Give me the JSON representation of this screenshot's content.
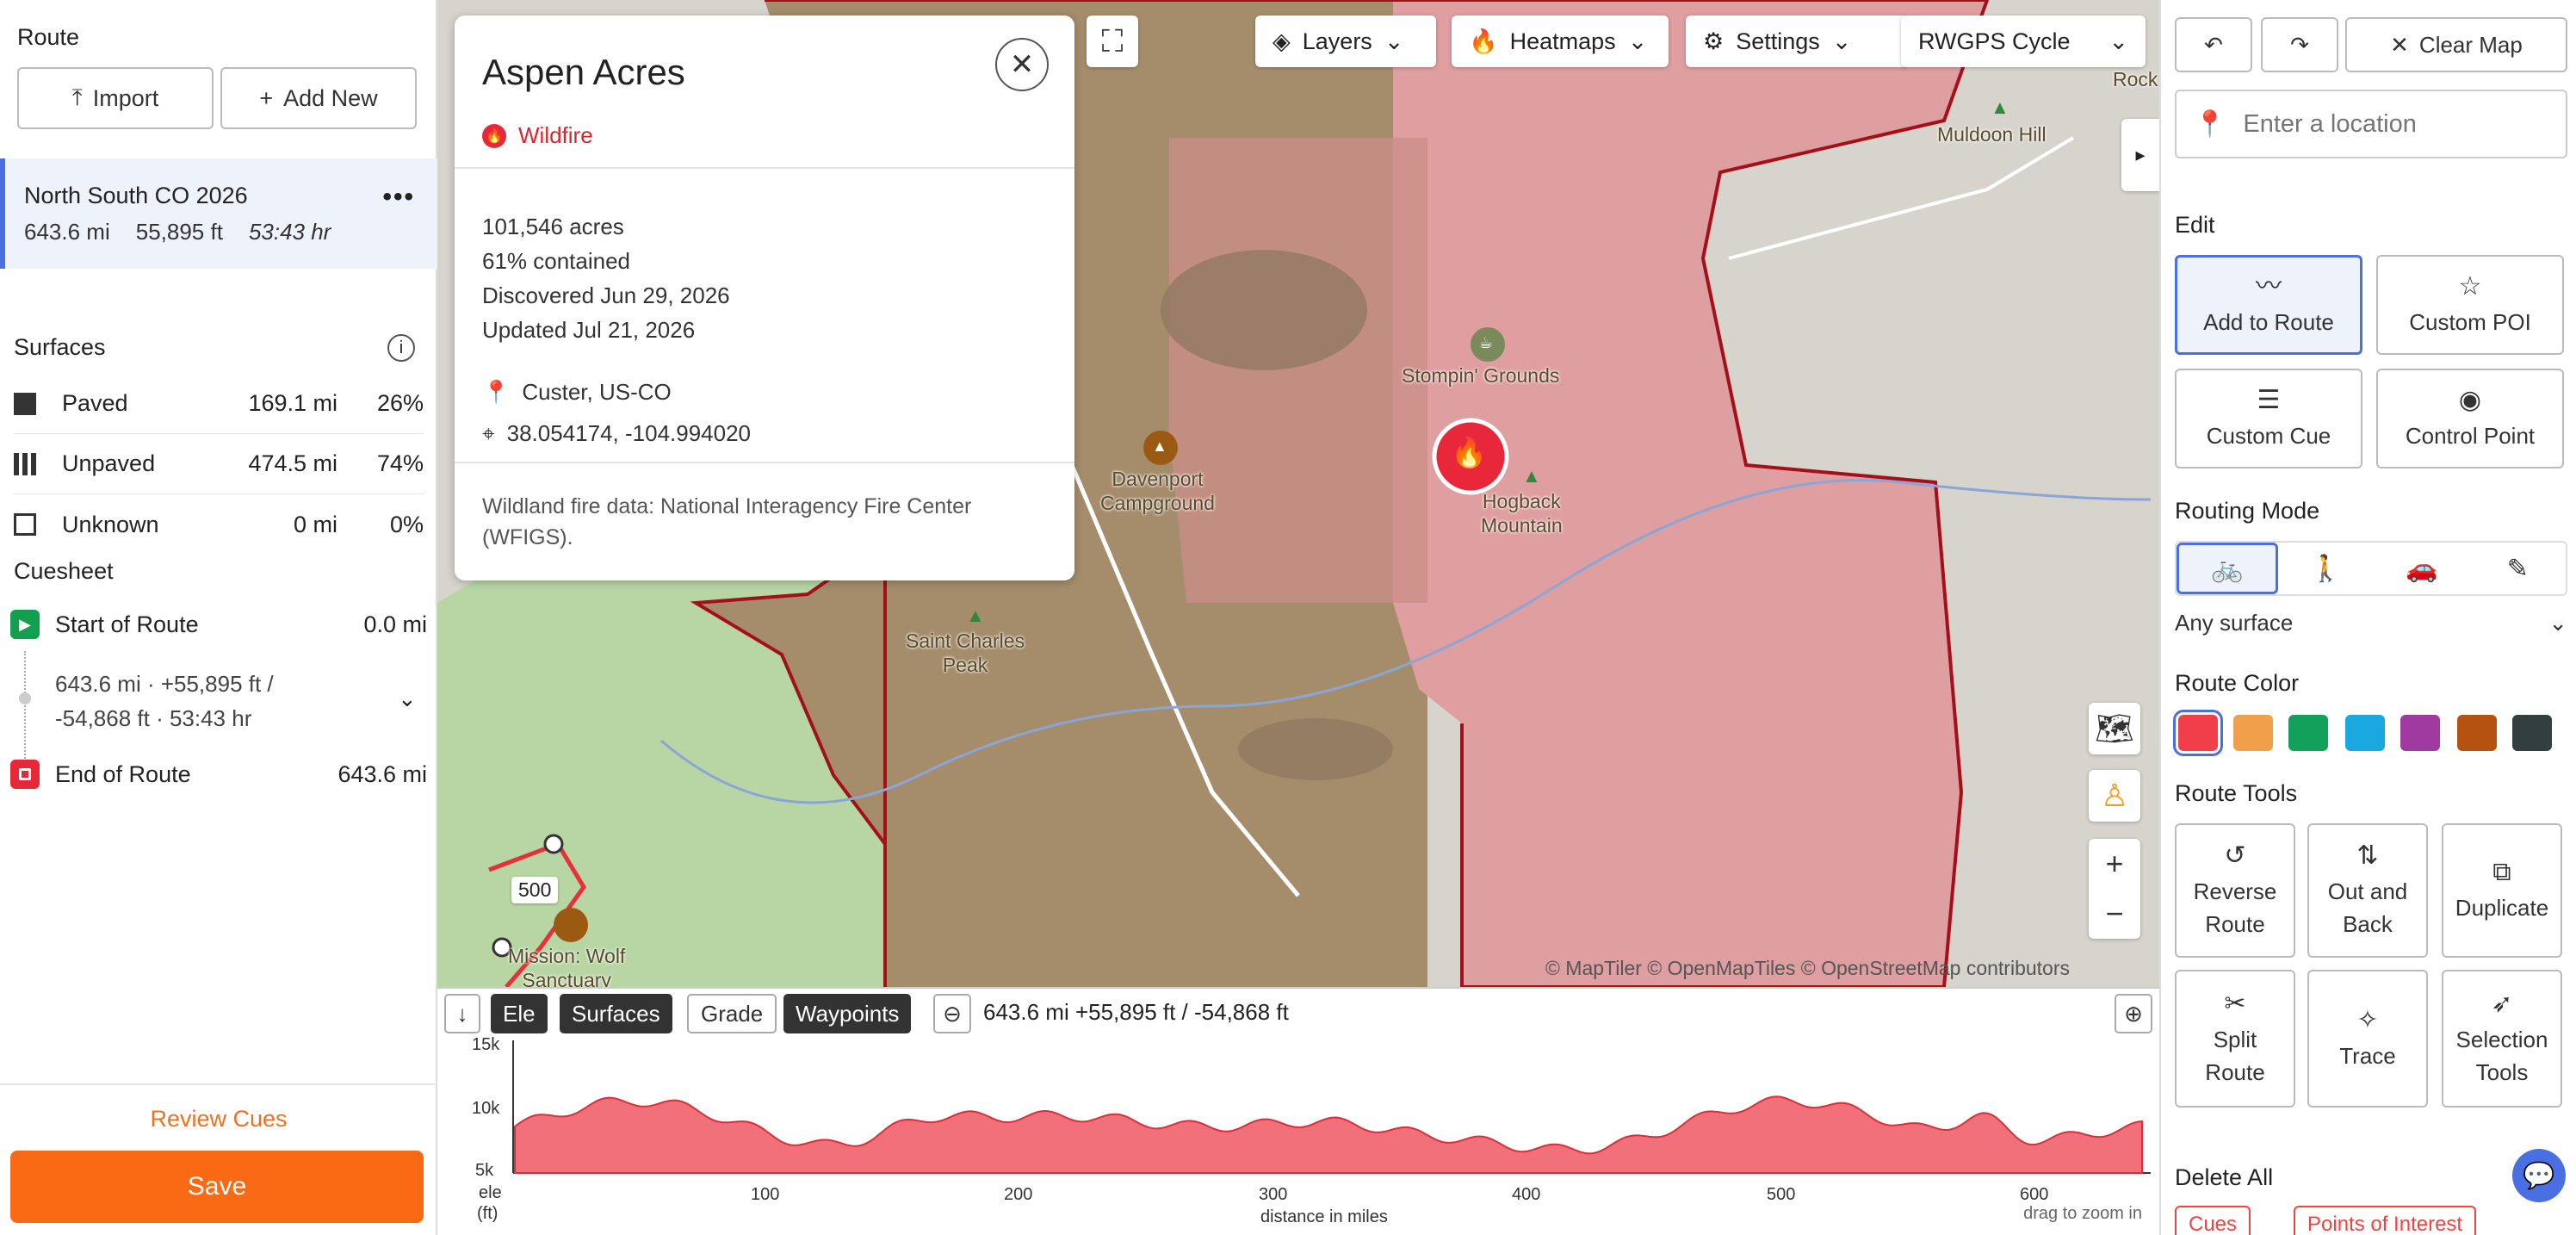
{
  "left": {
    "route_heading": "Route",
    "import_label": "Import",
    "add_new_label": "Add New",
    "route": {
      "name": "North South CO 2026",
      "distance": "643.6 mi",
      "elevation": "55,895 ft",
      "duration": "53:43 hr"
    },
    "surfaces_heading": "Surfaces",
    "surfaces": [
      {
        "name": "Paved",
        "miles": "169.1 mi",
        "percent": "26%"
      },
      {
        "name": "Unpaved",
        "miles": "474.5 mi",
        "percent": "74%"
      },
      {
        "name": "Unknown",
        "miles": "0 mi",
        "percent": "0%"
      }
    ],
    "cuesheet_heading": "Cuesheet",
    "cues": {
      "start_label": "Start of Route",
      "start_dist": "0.0 mi",
      "summary_line1": "643.6 mi · +55,895 ft /",
      "summary_line2": "-54,868 ft · 53:43 hr",
      "end_label": "End of Route",
      "end_dist": "643.6 mi"
    },
    "review_cues_label": "Review Cues",
    "save_label": "Save"
  },
  "map": {
    "toolbar": {
      "layers": "Layers",
      "heatmaps": "Heatmaps",
      "settings": "Settings",
      "map_style": "RWGPS Cycle"
    },
    "labels": {
      "rock": "Rock",
      "muldoon": "Muldoon Hill",
      "stompin": "Stompin' Grounds",
      "davenport": "Davenport\nCampground",
      "hogback": "Hogback\nMountain",
      "saint_charles": "Saint Charles\nPeak",
      "mission_wolf": "Mission: Wolf\nSanctuary",
      "route_marker": "500"
    },
    "attribution": "© MapTiler © OpenMapTiles © OpenStreetMap contributors",
    "popup": {
      "title": "Aspen Acres",
      "type": "Wildfire",
      "acres": "101,546 acres",
      "contained": "61% contained",
      "discovered": "Discovered Jun 29, 2026",
      "updated": "Updated Jul 21, 2026",
      "location": "Custer, US-CO",
      "coords": "38.054174, -104.994020",
      "source": "Wildland fire data: National Interagency Fire Center (WFIGS)."
    }
  },
  "elevation": {
    "tabs": {
      "ele": "Ele",
      "surfaces": "Surfaces",
      "grade": "Grade",
      "waypoints": "Waypoints"
    },
    "summary": "643.6 mi +55,895 ft / -54,868 ft",
    "y_ticks": [
      "15k",
      "10k",
      "5k"
    ],
    "x_ticks": [
      "100",
      "200",
      "300",
      "400",
      "500",
      "600"
    ],
    "y_label_1": "ele",
    "y_label_2": "(ft)",
    "x_label": "distance in miles",
    "hint": "drag to zoom in"
  },
  "right": {
    "clear_map": "Clear Map",
    "location_placeholder": "Enter a location",
    "edit_heading": "Edit",
    "edit_buttons": {
      "add_to_route": "Add to Route",
      "custom_poi": "Custom POI",
      "custom_cue": "Custom Cue",
      "control_point": "Control Point"
    },
    "routing_heading": "Routing Mode",
    "surface_option": "Any surface",
    "color_heading": "Route Color",
    "colors": [
      "#f03e4a",
      "#f0a04a",
      "#13a05a",
      "#1aa8e0",
      "#a03aa0",
      "#b55212",
      "#333f3f"
    ],
    "tools_heading": "Route Tools",
    "tools": {
      "reverse": "Reverse\nRoute",
      "out_back": "Out and\nBack",
      "duplicate": "Duplicate",
      "split": "Split\nRoute",
      "trace": "Trace",
      "selection": "Selection\nTools"
    },
    "delete_heading": "Delete All",
    "delete_cues": "Cues",
    "delete_poi": "Points of Interest"
  }
}
